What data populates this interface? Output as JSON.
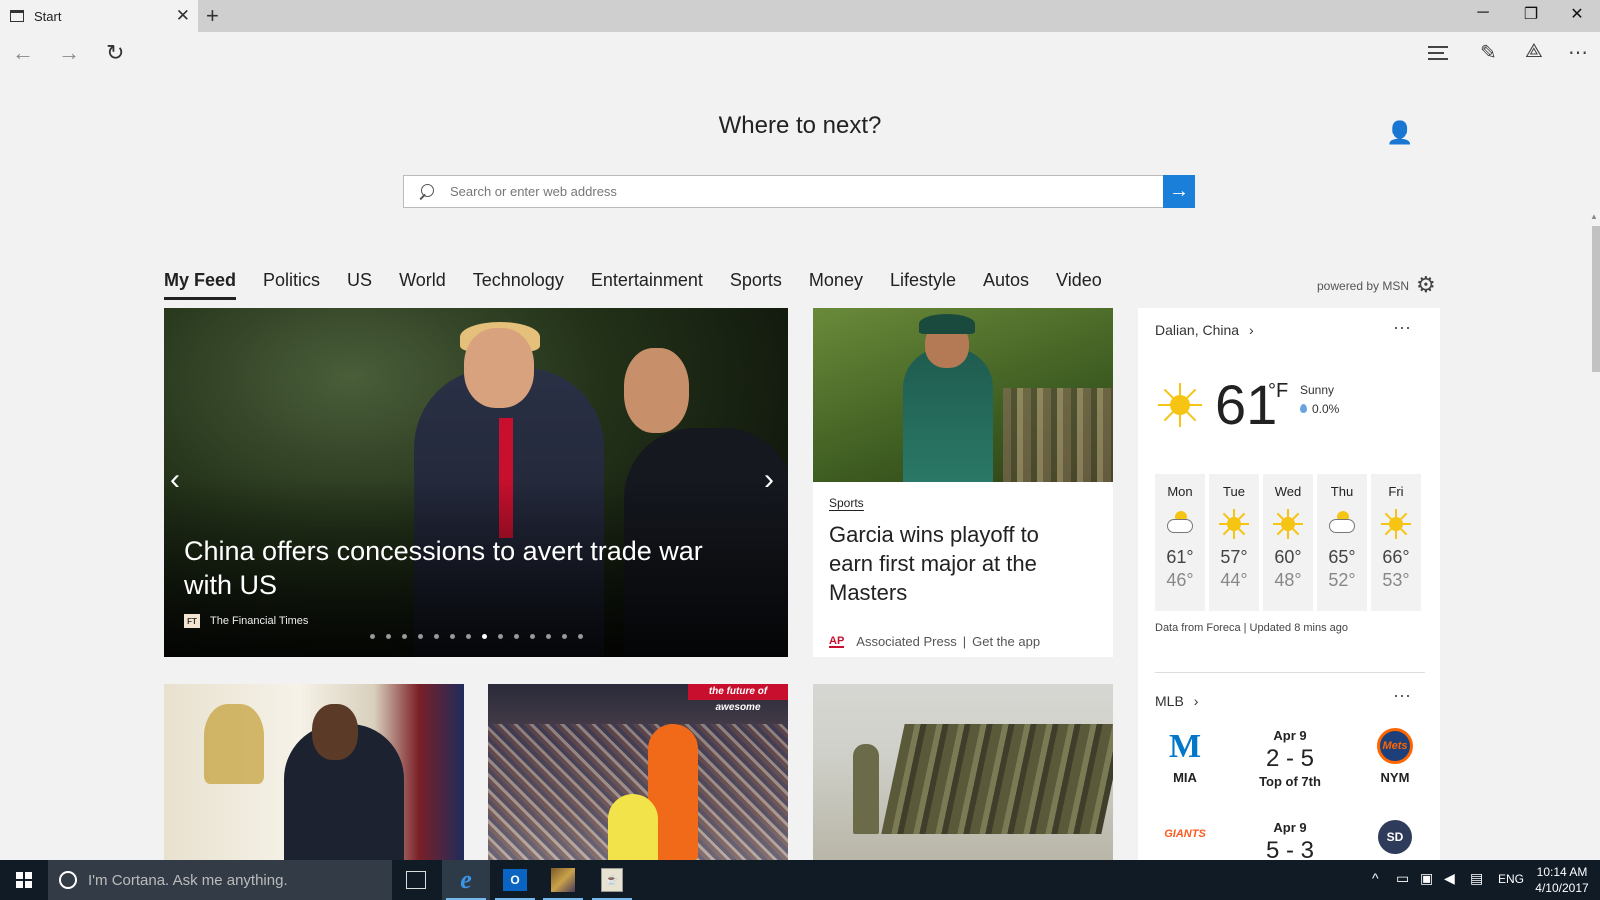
{
  "tab": {
    "title": "Start",
    "close_glyph": "✕",
    "new_glyph": "+"
  },
  "window": {
    "minimize": "─",
    "restore": "❐",
    "close": "✕"
  },
  "nav": {
    "back": "←",
    "forward": "→",
    "refresh": "↻",
    "more": "⋯",
    "notes": "✎",
    "share": "⟁"
  },
  "page": {
    "heading": "Where to next?",
    "search_placeholder": "Search or enter web address",
    "go": "→",
    "profile": "👤"
  },
  "categories": [
    "My Feed",
    "Politics",
    "US",
    "World",
    "Technology",
    "Entertainment",
    "Sports",
    "Money",
    "Lifestyle",
    "Autos",
    "Video"
  ],
  "powered_by": "powered by MSN",
  "settings_glyph": "⚙",
  "hero": {
    "title": "China offers concessions to avert trade war with US",
    "source_logo": "FT",
    "source": "The Financial Times",
    "prev": "‹",
    "next": "›",
    "slide_count": 14,
    "active_slide": 7
  },
  "story2": {
    "category": "Sports",
    "title": "Garcia wins playoff to earn first major at the Masters",
    "source_logo": "AP",
    "source": "Associated Press",
    "sep": "|",
    "get_app": "Get the app"
  },
  "weather": {
    "location": "Dalian, China",
    "chevron": "›",
    "more": "⋯",
    "temp": "61",
    "unit": "°F",
    "condition": "Sunny",
    "precip": "0.0%",
    "forecast": [
      {
        "day": "Mon",
        "icon": "partly-cloudy-icon",
        "hi": "61°",
        "lo": "46°"
      },
      {
        "day": "Tue",
        "icon": "sun-icon",
        "hi": "57°",
        "lo": "44°"
      },
      {
        "day": "Wed",
        "icon": "sun-icon",
        "hi": "60°",
        "lo": "48°"
      },
      {
        "day": "Thu",
        "icon": "partly-cloudy-icon",
        "hi": "65°",
        "lo": "52°"
      },
      {
        "day": "Fri",
        "icon": "sun-icon",
        "hi": "66°",
        "lo": "53°"
      }
    ],
    "attribution": "Data from Foreca | Updated 8 mins ago"
  },
  "mlb": {
    "title": "MLB",
    "chevron": "›",
    "more": "⋯",
    "games": [
      {
        "date": "Apr 9",
        "score": "2 - 5",
        "status": "Top of 7th",
        "home": "MIA",
        "away": "NYM",
        "home_logo": "M",
        "away_logo": "Mets"
      },
      {
        "date": "Apr 9",
        "score": "5 - 3",
        "status": "",
        "home": "",
        "away": "",
        "home_logo": "GIANTS",
        "away_logo": "SD"
      }
    ]
  },
  "bottom_cards": {
    "bball_banner": "the future of awesome"
  },
  "taskbar": {
    "cortana": "I'm Cortana. Ask me anything.",
    "edge_glyph": "e",
    "outlook_glyph": "O",
    "app4_glyph": "☕",
    "tray_up": "^",
    "lang": "ENG",
    "time": "10:14 AM",
    "date": "4/10/2017"
  },
  "colors": {
    "accent": "#1a7fd9",
    "taskbar": "#101b26",
    "sun": "#f6c514"
  }
}
